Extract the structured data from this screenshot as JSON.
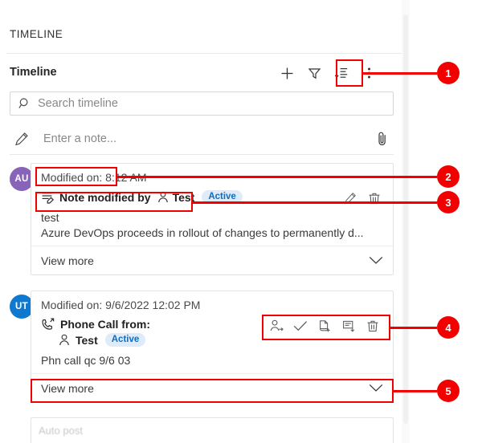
{
  "panel": {
    "title": "TIMELINE",
    "section_heading": "Timeline"
  },
  "toolbar": {
    "add_label": "add-record",
    "filter_label": "filter",
    "sort_label": "sort",
    "more_label": "more-commands"
  },
  "search": {
    "placeholder": "Search timeline",
    "icon": "search-icon"
  },
  "note": {
    "placeholder": "Enter a note...",
    "pencil_icon": "pencil-icon",
    "attach_icon": "paperclip-icon"
  },
  "cards": [
    {
      "avatar": "AU",
      "avatar_color": "#8764b8",
      "modified": "Modified on: 8:12 AM",
      "type_icon": "note-icon",
      "subject": "Note modified by",
      "person_icon": "person-icon",
      "person": "Test",
      "status": "Active",
      "body_line1": "test",
      "body_line2": "Azure DevOps proceeds in rollout of changes to permanently d...",
      "view_more": "View more",
      "actions": [
        "edit-icon",
        "delete-icon"
      ]
    },
    {
      "avatar": "UT",
      "avatar_color": "#0f79d0",
      "modified": "Modified on: 9/6/2022 12:02 PM",
      "type_icon": "phone-icon",
      "subject": "Phone Call from:",
      "person_icon": "person-icon",
      "person": "Test",
      "status": "Active",
      "body_line1": "Phn call qc 9/6 03",
      "view_more": "View more",
      "actions": [
        "assign-icon",
        "check-icon",
        "add-to-queue-icon",
        "convert-to-case-icon",
        "delete-icon"
      ]
    },
    {
      "cut_off_text": "Auto post"
    }
  ],
  "callouts": [
    {
      "number": "1"
    },
    {
      "number": "2"
    },
    {
      "number": "3"
    },
    {
      "number": "4"
    },
    {
      "number": "5"
    }
  ],
  "colors": {
    "annotation": "#f20000",
    "accent_blue": "#0f6cbd",
    "badge_bg": "#deecf9"
  }
}
